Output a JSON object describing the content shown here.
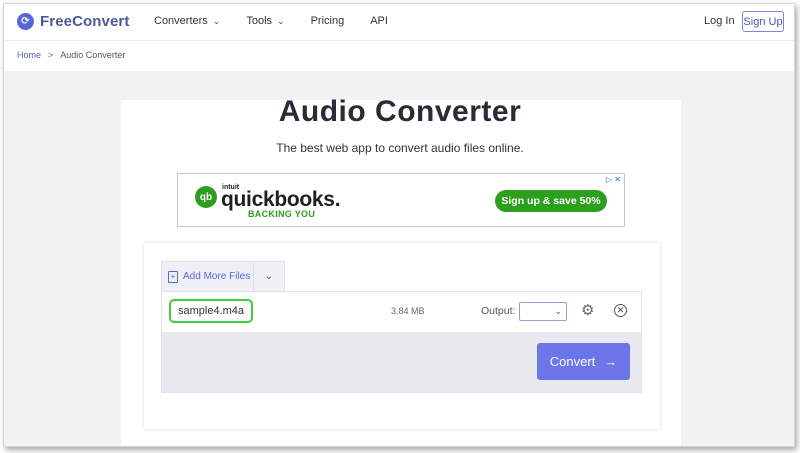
{
  "header": {
    "logo_text": "FreeConvert",
    "nav": [
      {
        "label": "Converters",
        "has_dropdown": true
      },
      {
        "label": "Tools",
        "has_dropdown": true
      },
      {
        "label": "Pricing",
        "has_dropdown": false
      },
      {
        "label": "API",
        "has_dropdown": false
      }
    ],
    "login": "Log In",
    "signup": "Sign Up"
  },
  "breadcrumb": {
    "home": "Home",
    "separator": ">",
    "current": "Audio Converter"
  },
  "main": {
    "title": "Audio Converter",
    "subtitle": "The best web app to convert audio files online."
  },
  "ad": {
    "brand_top": "intuit",
    "brand_name": "quickbooks.",
    "tagline": "BACKING YOU",
    "cta": "Sign up & save 50%",
    "corner": "▷ ✕"
  },
  "uploader": {
    "add_more_label": "Add More Files",
    "file": {
      "name": "sample4.m4a",
      "size": "3.84 MB",
      "output_label": "Output:",
      "output_value": ""
    },
    "convert_label": "Convert"
  },
  "colors": {
    "accent": "#5a67d8",
    "convert_button": "#6c76e8",
    "highlight": "#3cd13c",
    "ad_green": "#2ca01c"
  },
  "icons": [
    "logo-icon",
    "chevron-down-icon",
    "add-file-icon",
    "gear-icon",
    "close-circle-icon",
    "arrow-right-icon"
  ]
}
